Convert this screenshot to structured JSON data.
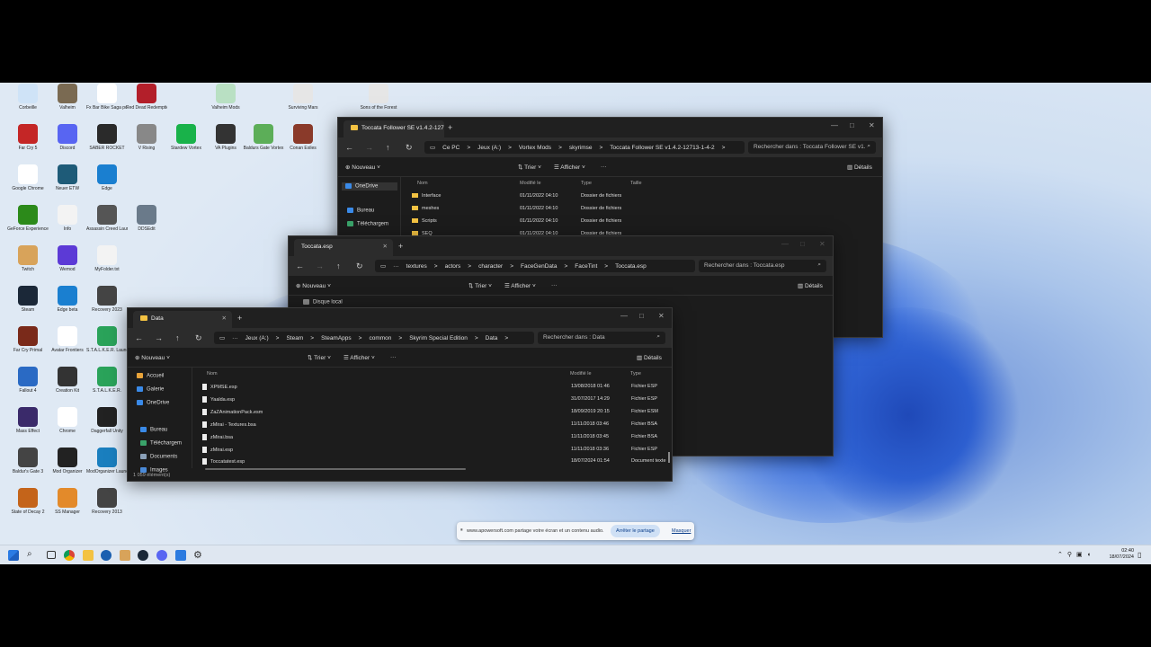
{
  "desktop_icons": [
    {
      "label": "Corbeille",
      "color": "#cfe3f7",
      "icon": "recycle-bin-icon"
    },
    {
      "label": "Valheim",
      "color": "#7a6a52",
      "icon": "valheim-icon"
    },
    {
      "label": "Fx Bar Bike Saga pc le 9",
      "color": "#ffffff",
      "icon": "video-file-icon"
    },
    {
      "label": "Red Dead Redemption 2",
      "color": "#b31f2a",
      "icon": "rdr2-icon"
    },
    {
      "label": "Valheim Mods",
      "color": "#b9e0c3",
      "icon": "mod-icon"
    },
    {
      "label": "Surviving Mars",
      "color": "#e6e6e6",
      "icon": "text-file-icon"
    },
    {
      "label": "Sons of the Forest",
      "color": "#e6e6e6",
      "icon": "text-file-icon"
    },
    {
      "label": "Far Cry 5",
      "color": "#c42626",
      "icon": "skull-icon"
    },
    {
      "label": "Discord",
      "color": "#5865f2",
      "icon": "discord-icon"
    },
    {
      "label": "SABER ROCKET",
      "color": "#2a2a2a",
      "icon": "game-icon"
    },
    {
      "label": "V Rising",
      "color": "#888888",
      "icon": "game-icon"
    },
    {
      "label": "Stardew Vortex",
      "color": "#19b24a",
      "icon": "vortex-icon"
    },
    {
      "label": "VA Plugins",
      "color": "#333333",
      "icon": "voiceattack-icon"
    },
    {
      "label": "Baldurs Gate Vortex",
      "color": "#5cae58",
      "icon": "mod-icon"
    },
    {
      "label": "Conan Exiles",
      "color": "#8a3a2a",
      "icon": "game-icon"
    },
    {
      "label": "Google Chrome",
      "color": "#ffffff",
      "icon": "chrome-icon"
    },
    {
      "label": "Neuer ETW",
      "color": "#1e5b78",
      "icon": "edge-dev-icon"
    },
    {
      "label": "Edge",
      "color": "#1a7fd0",
      "icon": "edge-icon"
    },
    {
      "label": "GeForce Experience",
      "color": "#2c8a1a",
      "icon": "nvidia-icon"
    },
    {
      "label": "Info",
      "color": "#f3f3f3",
      "icon": "text-file-icon"
    },
    {
      "label": "Assassin Creed Launcher",
      "color": "#555555",
      "icon": "assassin-icon"
    },
    {
      "label": "DDSEdit",
      "color": "#6a7a8a",
      "icon": "monitor-icon"
    },
    {
      "label": "Twitch",
      "color": "#d8a35a",
      "icon": "tornado-icon"
    },
    {
      "label": "Wemod",
      "color": "#5c3ad6",
      "icon": "wemod-icon"
    },
    {
      "label": "MyFolder.txt",
      "color": "#f3f3f3",
      "icon": "text-file-icon"
    },
    {
      "label": "Steam",
      "color": "#1b2838",
      "icon": "steam-icon"
    },
    {
      "label": "Edge beta",
      "color": "#1a7fd0",
      "icon": "edge-icon"
    },
    {
      "label": "Recovery 2023",
      "color": "#444444",
      "icon": "app-icon"
    },
    {
      "label": "Far Cry Primal",
      "color": "#7a2a1a",
      "icon": "game-icon"
    },
    {
      "label": "Avatar Frontiers",
      "color": "#ffffff",
      "icon": "video-file-icon"
    },
    {
      "label": "S.T.A.L.K.E.R. Launcher",
      "color": "#2aa35a",
      "icon": "stalker-icon"
    },
    {
      "label": "Fallout 4",
      "color": "#2a6ac4",
      "icon": "game-icon"
    },
    {
      "label": "Creation Kit",
      "color": "#333333",
      "icon": "game-icon"
    },
    {
      "label": "S.T.A.L.K.E.R.",
      "color": "#2aa35a",
      "icon": "stalker-icon"
    },
    {
      "label": "Mass Effect",
      "color": "#3a2a6a",
      "icon": "game-icon"
    },
    {
      "label": "Chrome",
      "color": "#ffffff",
      "icon": "chrome-icon"
    },
    {
      "label": "Daggerfall Unity",
      "color": "#222222",
      "icon": "game-icon"
    },
    {
      "label": "Baldur's Gate 3",
      "color": "#444444",
      "icon": "bg3-icon"
    },
    {
      "label": "Mod Organizer",
      "color": "#222222",
      "icon": "game-icon"
    },
    {
      "label": "ModOrganizer Launcher",
      "color": "#1a7fbf",
      "icon": "mo2-icon"
    },
    {
      "label": "State of Decay 2",
      "color": "#c4641a",
      "icon": "game-icon"
    },
    {
      "label": "SS Manager",
      "color": "#e38a2a",
      "icon": "ss-icon"
    },
    {
      "label": "Recovery 2013",
      "color": "#444444",
      "icon": "app-icon"
    }
  ],
  "window1": {
    "tab_title": "Toccata Follower SE v1.4.2-127",
    "breadcrumb": [
      "Ce PC",
      ">",
      "Jeux (A:)",
      ">",
      "Vortex Mods",
      ">",
      "skyrimse",
      ">",
      "Toccata Follower SE v1.4.2-12713-1-4-2",
      ">"
    ],
    "search_placeholder": "Rechercher dans : Toccata Follower SE v1.",
    "toolbar": {
      "new": "Nouveau",
      "sort": "Trier",
      "view": "Afficher",
      "details": "Détails"
    },
    "sidebar": [
      "OneDrive",
      "Bureau",
      "Téléchargem"
    ],
    "columns": {
      "name": "Nom",
      "modified": "Modifié le",
      "type": "Type",
      "size": "Taille"
    },
    "rows": [
      {
        "name": "Interface",
        "date": "01/11/2022 04:10",
        "type": "Dossier de fichiers"
      },
      {
        "name": "meshes",
        "date": "01/11/2022 04:10",
        "type": "Dossier de fichiers"
      },
      {
        "name": "Scripts",
        "date": "01/11/2022 04:10",
        "type": "Dossier de fichiers"
      },
      {
        "name": "SEQ",
        "date": "01/11/2022 04:10",
        "type": "Dossier de fichiers"
      }
    ]
  },
  "window2": {
    "tab_title": "Toccata.esp",
    "breadcrumb": [
      "textures",
      ">",
      "actors",
      ">",
      "character",
      ">",
      "FaceGenData",
      ">",
      "FaceTint",
      ">",
      "Toccata.esp"
    ],
    "search_placeholder": "Rechercher dans : Toccata.esp",
    "toolbar": {
      "new": "Nouveau",
      "sort": "Trier",
      "view": "Afficher",
      "details": "Détails"
    },
    "sidebar": [
      "Disque local"
    ]
  },
  "window3": {
    "tab_title": "Data",
    "breadcrumb": [
      "Jeux (A:)",
      ">",
      "Steam",
      ">",
      "SteamApps",
      ">",
      "common",
      ">",
      "Skyrim Special Edition",
      ">",
      "Data",
      ">"
    ],
    "search_placeholder": "Rechercher dans : Data",
    "toolbar": {
      "new": "Nouveau",
      "sort": "Trier",
      "view": "Afficher",
      "details": "Détails"
    },
    "sidebar": [
      {
        "label": "Accueil",
        "color": "#e8a33a"
      },
      {
        "label": "Galerie",
        "color": "#3a8ae8"
      },
      {
        "label": "OneDrive",
        "color": "#3a8ae8"
      },
      {
        "label": "Bureau",
        "color": "#3a8ae8"
      },
      {
        "label": "Téléchargem",
        "color": "#3aa36a"
      },
      {
        "label": "Documents",
        "color": "#8aa0b8"
      },
      {
        "label": "Images",
        "color": "#4a8ad8"
      }
    ],
    "columns": {
      "name": "Nom",
      "modified": "Modifié le",
      "type": "Type"
    },
    "rows": [
      {
        "name": "XPMSE.esp",
        "date": "13/08/2018 01:46",
        "type": "Fichier ESP"
      },
      {
        "name": "Yaalda.esp",
        "date": "31/07/2017 14:29",
        "type": "Fichier ESP"
      },
      {
        "name": "ZaZAnimationPack.esm",
        "date": "18/09/2019 20:15",
        "type": "Fichier ESM"
      },
      {
        "name": "zMirai - Textures.bsa",
        "date": "11/11/2018 03:46",
        "type": "Fichier BSA"
      },
      {
        "name": "zMirai.bsa",
        "date": "11/11/2018 03:45",
        "type": "Fichier BSA"
      },
      {
        "name": "zMirai.esp",
        "date": "11/11/2018 03:36",
        "type": "Fichier ESP"
      },
      {
        "name": "Toccatatest.esp",
        "date": "18/07/2024 01:54",
        "type": "Document texte"
      }
    ],
    "status": "1 059 élément(s)"
  },
  "share_bar": {
    "message": "www.apowersoft.com partage votre écran et un contenu audio.",
    "stop": "Arrêter le partage",
    "hide": "Masquer"
  },
  "taskbar": {
    "time": "02:40",
    "date": "18/07/2024"
  }
}
